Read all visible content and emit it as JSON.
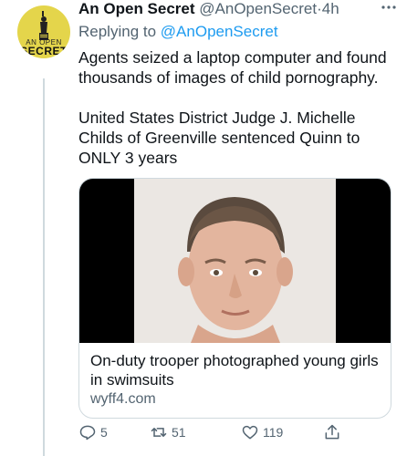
{
  "tweet": {
    "author_name": "An Open Secret",
    "author_handle": "@AnOpenSecret",
    "separator": "·",
    "time": "4h",
    "more_icon": "more-horizontal-icon",
    "replying_prefix": "Replying to",
    "replying_to": "@AnOpenSecret",
    "body_paragraph_1": "Agents seized a laptop computer and found thousands of images of child pornography.",
    "body_paragraph_2": "United States District Judge J. Michelle Childs of Greenville sentenced Quinn to ONLY 3 years"
  },
  "avatar": {
    "line1": "AN OPEN",
    "line2": "SECRET",
    "bg_color": "#e4d54b"
  },
  "link_card": {
    "title": "On-duty trooper photographed young girls in swimsuits",
    "domain": "wyff4.com"
  },
  "actions": {
    "reply_count": "5",
    "retweet_count": "51",
    "like_count": "119",
    "reply_icon": "reply-icon",
    "retweet_icon": "retweet-icon",
    "like_icon": "heart-icon",
    "share_icon": "share-icon"
  },
  "colors": {
    "text_primary": "#0f1419",
    "text_secondary": "#536471",
    "link": "#1d9bf0",
    "border": "#cfd9de"
  }
}
